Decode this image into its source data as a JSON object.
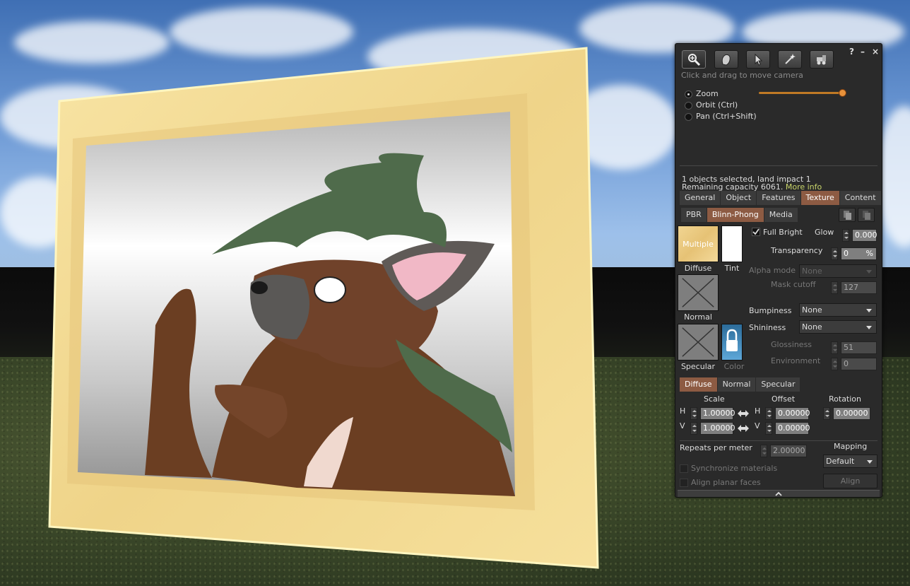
{
  "floater": {
    "help": "?",
    "minimize": "–",
    "close": "×",
    "tools": [
      {
        "name": "zoom-tool-icon"
      },
      {
        "name": "grab-tool-icon"
      },
      {
        "name": "select-tool-icon"
      },
      {
        "name": "create-tool-icon"
      },
      {
        "name": "land-tool-icon"
      }
    ],
    "hint": "Click and drag to move camera",
    "camera_modes": [
      "Zoom",
      "Orbit (Ctrl)",
      "Pan (Ctrl+Shift)"
    ],
    "selected_mode": "Zoom",
    "selection_info_1": "1 objects selected, land impact 1",
    "selection_info_2": "Remaining capacity 6061.",
    "more_info": "More info",
    "main_tabs": [
      "General",
      "Object",
      "Features",
      "Texture",
      "Content"
    ],
    "active_main_tab": "Texture",
    "mat_tabs": [
      "PBR",
      "Blinn-Phong",
      "Media"
    ],
    "active_mat_tab": "Blinn-Phong"
  },
  "texture": {
    "diffuse_swatch_text": "Multiple",
    "diffuse_label": "Diffuse",
    "tint_label": "Tint",
    "normal_label": "Normal",
    "specular_label": "Specular",
    "color_label": "Color",
    "full_bright": "Full Bright",
    "glow_label": "Glow",
    "glow_value": "0.000",
    "transparency_label": "Transparency",
    "transparency_value": "0",
    "transparency_unit": "%",
    "alpha_mode_label": "Alpha mode",
    "alpha_mode_value": "None",
    "mask_cutoff_label": "Mask cutoff",
    "mask_cutoff_value": "127",
    "bumpiness_label": "Bumpiness",
    "bumpiness_value": "None",
    "shininess_label": "Shininess",
    "shininess_value": "None",
    "glossiness_label": "Glossiness",
    "glossiness_value": "51",
    "environment_label": "Environment",
    "environment_value": "0",
    "map_tabs": [
      "Diffuse",
      "Normal",
      "Specular"
    ],
    "active_map_tab": "Diffuse",
    "scale_header": "Scale",
    "offset_header": "Offset",
    "rotation_header": "Rotation",
    "h_label": "H",
    "v_label": "V",
    "scale_h": "1.00000",
    "scale_v": "1.00000",
    "offset_h": "0.00000",
    "offset_v": "0.00000",
    "rotation": "0.00000",
    "repeats_label": "Repeats per meter",
    "repeats_value": "2.00000",
    "mapping_label": "Mapping",
    "mapping_value": "Default",
    "sync_materials": "Synchronize materials",
    "align_planar": "Align planar faces",
    "align_button": "Align",
    "expand_icon": "chevron-up-icon"
  },
  "colors": {
    "accent_tab": "#8d5b43",
    "link": "#c8d46a",
    "frame_wood": "#f3dc96"
  }
}
